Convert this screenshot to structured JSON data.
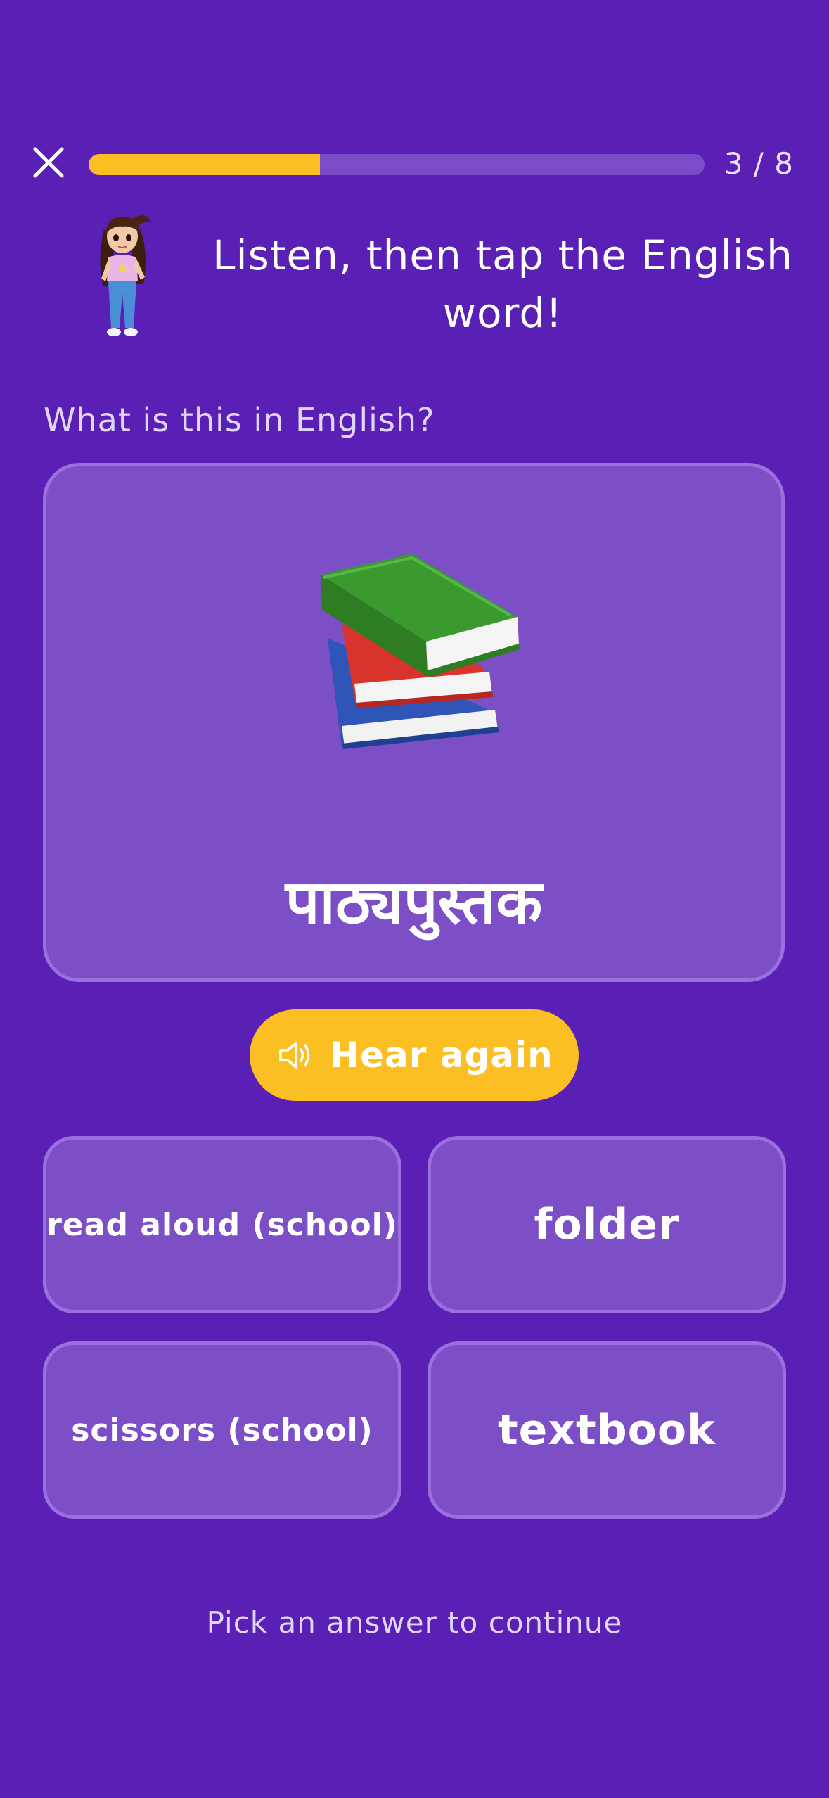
{
  "header": {
    "close_icon": "close-icon",
    "progress_current": 3,
    "progress_total": 8,
    "progress_fraction": 0.375,
    "progress_text": "3 / 8"
  },
  "instruction": {
    "avatar_icon": "girl-character-icon",
    "text": "Listen, then tap the English word!"
  },
  "question": {
    "prompt": "What is this in English?",
    "image_icon": "books-icon",
    "word": "पाठ्यपुस्तक"
  },
  "hear_button": {
    "icon": "speaker-icon",
    "label": "Hear again"
  },
  "options": [
    {
      "label": "read aloud (school)"
    },
    {
      "label": "folder"
    },
    {
      "label": "scissors (school)"
    },
    {
      "label": "textbook"
    }
  ],
  "footer": {
    "text": "Pick an answer to continue"
  },
  "colors": {
    "background": "#5a1fb5",
    "card": "#7c4fc6",
    "card_border": "#9a6fe0",
    "accent": "#fbbf24"
  }
}
